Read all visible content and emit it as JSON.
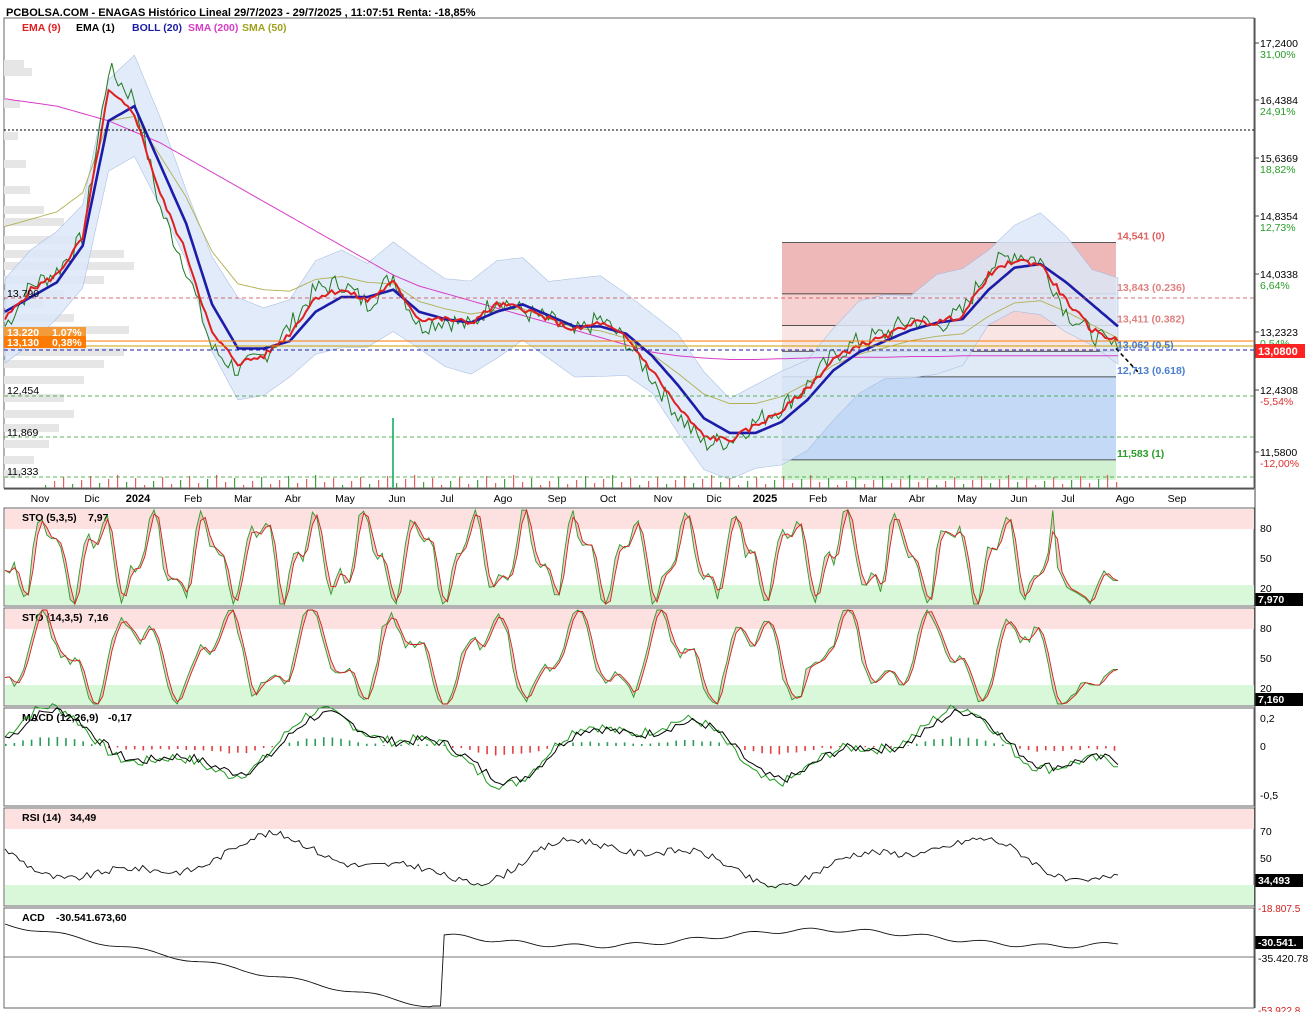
{
  "header": {
    "title": "PCBOLSA.COM - ENAGAS Histórico Lineal 29/7/2023 - 29/7/2025 , 11:07:51 Renta: -18,85%"
  },
  "legend": [
    {
      "label": "EMA (9)",
      "color": "#e02020"
    },
    {
      "label": "EMA (1)",
      "color": "#000000"
    },
    {
      "label": "BOLL (20)",
      "color": "#1c1ca8"
    },
    {
      "label": "SMA (200)",
      "color": "#d83cc8"
    },
    {
      "label": "SMA (50)",
      "color": "#a0a020"
    }
  ],
  "price_axis": [
    {
      "price": "17,2400",
      "pct": "31,00%"
    },
    {
      "price": "16,4384",
      "pct": "24,91%"
    },
    {
      "price": "15,6369",
      "pct": "18,82%"
    },
    {
      "price": "14,8354",
      "pct": "12,73%"
    },
    {
      "price": "14,0338",
      "pct": "6,64%"
    },
    {
      "price": "13,2323",
      "pct": "0,54%"
    },
    {
      "price": "12,4308",
      "pct": "-5,54%"
    },
    {
      "price": "11,5800",
      "pct": "-12,00%"
    }
  ],
  "last_price_badge": "13,0800",
  "left_labels": {
    "l1": "13,790",
    "l2": "13,220",
    "l2_pct": "1,07%",
    "l3": "13,130",
    "l3_pct": "0,38%",
    "l4": "12,454",
    "l5": "11,869",
    "l6": "11,333"
  },
  "fibonacci": [
    {
      "label": "14,541 (0)",
      "color": "#e06060"
    },
    {
      "label": "13,843 (0.236)",
      "color": "#e08080"
    },
    {
      "label": "13,411 (0.382)",
      "color": "#e08080"
    },
    {
      "label": "13,062 (0.5)",
      "color": "#4a7fd0"
    },
    {
      "label": "12,713 (0.618)",
      "color": "#4a7fd0"
    },
    {
      "label": "11,583 (1)",
      "color": "#2a9d2a"
    }
  ],
  "x_axis": [
    "Nov",
    "Dic",
    "2024",
    "Feb",
    "Mar",
    "Abr",
    "May",
    "Jun",
    "Jul",
    "Ago",
    "Sep",
    "Oct",
    "Nov",
    "Dic",
    "2025",
    "Feb",
    "Mar",
    "Abr",
    "May",
    "Jun",
    "Jul",
    "Ago",
    "Sep"
  ],
  "panels": {
    "sto1": {
      "title": "STO (5,3,5)",
      "value": "7,97",
      "badge": "7,970",
      "levels": [
        "80",
        "50",
        "20"
      ]
    },
    "sto2": {
      "title": "STO (14,3,5)",
      "value": "7,16",
      "badge": "7,160",
      "levels": [
        "80",
        "50",
        "20"
      ]
    },
    "macd": {
      "title": "MACD (12,26,9)",
      "value": "-0,17",
      "levels": [
        "0,2",
        "0",
        "-0,5"
      ]
    },
    "rsi": {
      "title": "RSI (14)",
      "value": "34,49",
      "badge": "34,493",
      "levels": [
        "70",
        "50"
      ],
      "cut_label": "-18.807.5"
    },
    "acd": {
      "title": "ACD",
      "value": "-30.541.673,60",
      "badge": "-30.541.",
      "levels": [
        "-35.420.78",
        "-53.922.8"
      ]
    }
  },
  "chart_data": {
    "type": "line",
    "title": "PCBOLSA.COM - ENAGAS Histórico Lineal 29/7/2023 - 29/7/2025 , 11:07:51 Renta: -18,85%",
    "x_range": [
      "29/7/2023",
      "29/7/2025"
    ],
    "ylim": [
      11.2,
      17.6
    ],
    "months": [
      "Nov",
      "Dic",
      "2024",
      "Feb",
      "Mar",
      "Abr",
      "May",
      "Jun",
      "Jul",
      "Ago",
      "Sep",
      "Oct",
      "Nov",
      "Dic",
      "2025",
      "Feb",
      "Mar",
      "Abr",
      "May",
      "Jun",
      "Jul"
    ],
    "series": [
      {
        "name": "EMA (1)",
        "values": [
          13.4,
          13.95,
          14.15,
          14.6,
          16.9,
          16.5,
          15.0,
          14.2,
          13.1,
          12.8,
          13.0,
          13.4,
          13.9,
          14.0,
          13.7,
          14.1,
          13.4,
          13.5,
          13.4,
          13.8,
          13.6,
          13.5,
          13.3,
          13.5,
          13.2,
          12.7,
          12.2,
          11.8,
          11.85,
          12.1,
          12.3,
          12.6,
          13.0,
          13.2,
          13.3,
          13.5,
          13.4,
          13.6,
          14.2,
          14.4,
          14.3,
          13.6,
          13.3,
          13.08
        ]
      },
      {
        "name": "EMA (9)",
        "values": [
          13.5,
          13.9,
          14.1,
          14.6,
          16.6,
          16.3,
          15.2,
          14.4,
          13.3,
          12.9,
          13.0,
          13.3,
          13.8,
          13.9,
          13.75,
          14.0,
          13.5,
          13.5,
          13.45,
          13.7,
          13.65,
          13.5,
          13.35,
          13.45,
          13.25,
          12.8,
          12.3,
          11.9,
          11.85,
          12.05,
          12.25,
          12.55,
          12.95,
          13.15,
          13.25,
          13.45,
          13.45,
          13.55,
          14.1,
          14.3,
          14.25,
          13.75,
          13.35,
          13.2
        ]
      },
      {
        "name": "BOLL (20)",
        "values": [
          13.6,
          13.8,
          14.0,
          14.5,
          16.2,
          16.4,
          15.6,
          14.8,
          13.7,
          13.1,
          13.1,
          13.2,
          13.6,
          13.8,
          13.8,
          13.9,
          13.6,
          13.5,
          13.45,
          13.6,
          13.7,
          13.55,
          13.4,
          13.4,
          13.3,
          13.0,
          12.6,
          12.15,
          11.95,
          11.95,
          12.1,
          12.4,
          12.8,
          13.05,
          13.2,
          13.35,
          13.45,
          13.5,
          13.9,
          14.2,
          14.25,
          14.0,
          13.7,
          13.4
        ]
      },
      {
        "name": "SMA (200)",
        "values": [
          16.5,
          16.45,
          16.4,
          16.3,
          16.2,
          16.05,
          15.9,
          15.7,
          15.5,
          15.3,
          15.1,
          14.9,
          14.7,
          14.5,
          14.3,
          14.1,
          13.95,
          13.85,
          13.75,
          13.65,
          13.55,
          13.45,
          13.35,
          13.25,
          13.15,
          13.05,
          13.0,
          12.97,
          12.95,
          12.95,
          12.96,
          12.97,
          12.98,
          12.98,
          12.98,
          12.99,
          12.99,
          13.0,
          13.0,
          13.0,
          13.0,
          13.0,
          13.0,
          13.0
        ]
      }
    ],
    "indicators": {
      "STO (5,3,5)": 7.97,
      "STO (14,3,5)": 7.16,
      "MACD (12,26,9)": -0.17,
      "RSI (14)": 34.49,
      "ACD": -30541673.6
    },
    "fibonacci_levels": [
      {
        "level": "0",
        "value": 14.541
      },
      {
        "level": "0.236",
        "value": 13.843
      },
      {
        "level": "0.382",
        "value": 13.411
      },
      {
        "level": "0.5",
        "value": 13.062
      },
      {
        "level": "0.618",
        "value": 12.713
      },
      {
        "level": "1",
        "value": 11.583
      }
    ]
  }
}
